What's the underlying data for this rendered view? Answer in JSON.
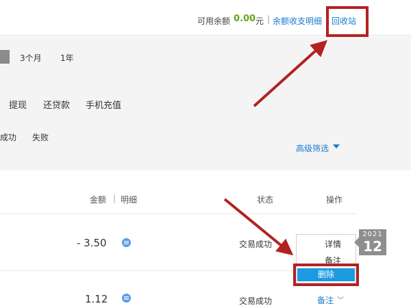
{
  "header": {
    "balance_label": "可用余额",
    "balance_amount": "0.00",
    "balance_unit": "元",
    "separator": "|",
    "detail_link": "余额收支明细",
    "recycle_link": "回收站"
  },
  "filters": {
    "periods": [
      "3个月",
      "1年"
    ],
    "types": [
      "提现",
      "还贷款",
      "手机充值"
    ],
    "statuses": [
      "成功",
      "失败"
    ],
    "advanced": "高级筛选"
  },
  "table": {
    "headers": {
      "amount": "金额",
      "divider": "|",
      "detail": "明细",
      "status": "状态",
      "action": "操作"
    },
    "rows": [
      {
        "amount": "- 3.50",
        "status": "交易成功"
      },
      {
        "amount": "1.12",
        "status": "交易成功",
        "action": "备注"
      }
    ]
  },
  "dropdown": {
    "items": [
      "详情",
      "备注",
      "删除"
    ]
  },
  "calendar_badge": {
    "year": "2021",
    "month": "12"
  },
  "colors": {
    "link": "#1a7bd0",
    "balance": "#6aa420",
    "highlight": "#b22222",
    "selected": "#1d9ae0"
  }
}
